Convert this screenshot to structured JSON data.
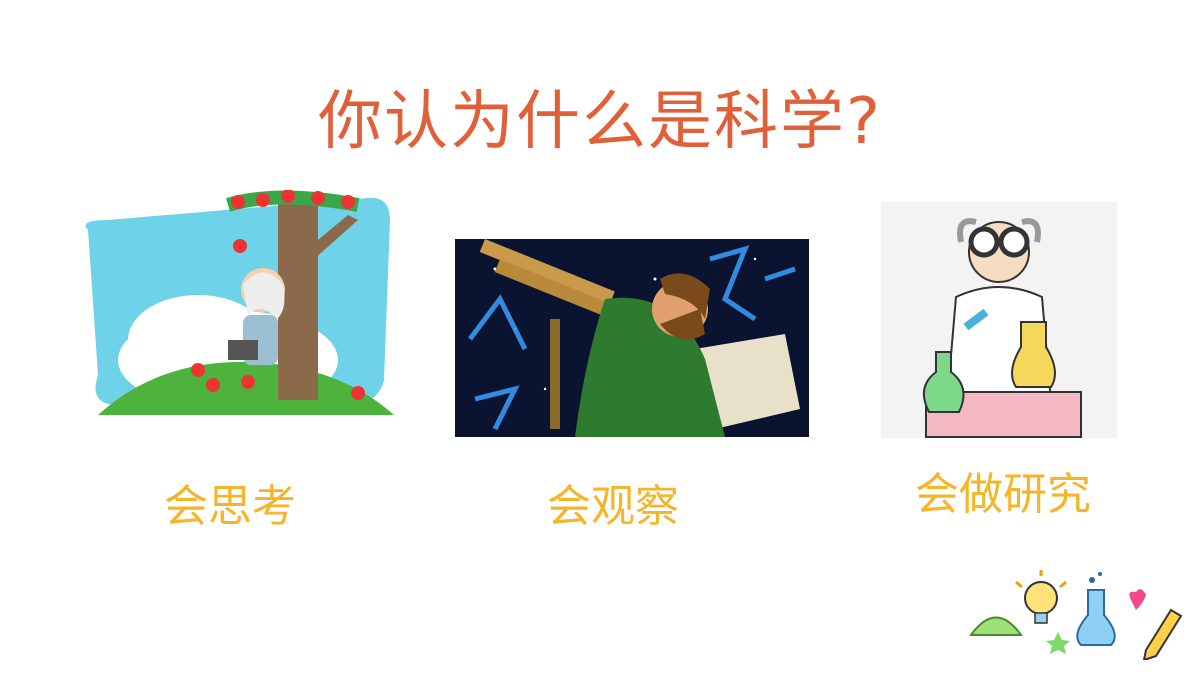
{
  "slide": {
    "title": "你认为什么是科学?"
  },
  "cards": [
    {
      "caption": "会思考",
      "image": "newton-under-apple-tree-illustration"
    },
    {
      "caption": "会观察",
      "image": "galileo-with-telescope-illustration"
    },
    {
      "caption": "会做研究",
      "image": "scientist-with-flasks-illustration"
    }
  ],
  "decoration": {
    "icons": [
      "protractor-icon",
      "lightbulb-icon",
      "flask-icon",
      "heart-icon",
      "pencil-icon",
      "star-icon"
    ]
  },
  "colors": {
    "title": "#e0603a",
    "caption": "#f5b52b"
  }
}
